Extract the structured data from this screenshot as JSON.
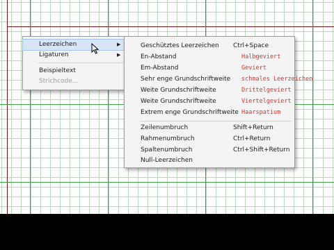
{
  "context_menu": {
    "items": [
      {
        "label": "Leerzeichen",
        "submenu": true,
        "highlighted": true
      },
      {
        "label": "Ligaturen",
        "submenu": true
      },
      {
        "label": "Beispieltext"
      },
      {
        "label": "Strichcode...",
        "disabled": true
      }
    ]
  },
  "submenu": {
    "items": [
      {
        "label": "Geschütztes Leerzeichen",
        "shortcut": "Ctrl+Space",
        "note": ""
      },
      {
        "label": "En-Abstand",
        "shortcut": "",
        "note": "Halbgeviert"
      },
      {
        "label": "Em-Abstand",
        "shortcut": "",
        "note": "Geviert"
      },
      {
        "label": "Sehr enge Grundschriftweite",
        "shortcut": "",
        "note": "schmales Leerzeichen"
      },
      {
        "label": "Weite Grundschriftweite",
        "shortcut": "",
        "note": "Drittelgeviert"
      },
      {
        "label": "Weite Grundschriftweite",
        "shortcut": "",
        "note": "Viertelgeviert"
      },
      {
        "label": "Extrem enge Grundschriftweite",
        "shortcut": "",
        "note": "Haarspatium"
      },
      {
        "label": "Zeilenumbruch",
        "shortcut": "Shift+Return",
        "note": ""
      },
      {
        "label": "Rahmenumbruch",
        "shortcut": "Ctrl+Return",
        "note": ""
      },
      {
        "label": "Spaltenumbruch",
        "shortcut": "Ctrl+Shift+Return",
        "note": ""
      },
      {
        "label": "Null-Leerzeichen",
        "shortcut": "",
        "note": ""
      }
    ]
  },
  "colors": {
    "grid_minor": "#b9d8bd",
    "grid_major": "#3fa04a",
    "margin_line": "#7a1010",
    "handwritten_note": "#e03030",
    "highlight": "#d7e5f7"
  },
  "icons": [
    "chevron-right-icon",
    "mouse-pointer-icon"
  ]
}
